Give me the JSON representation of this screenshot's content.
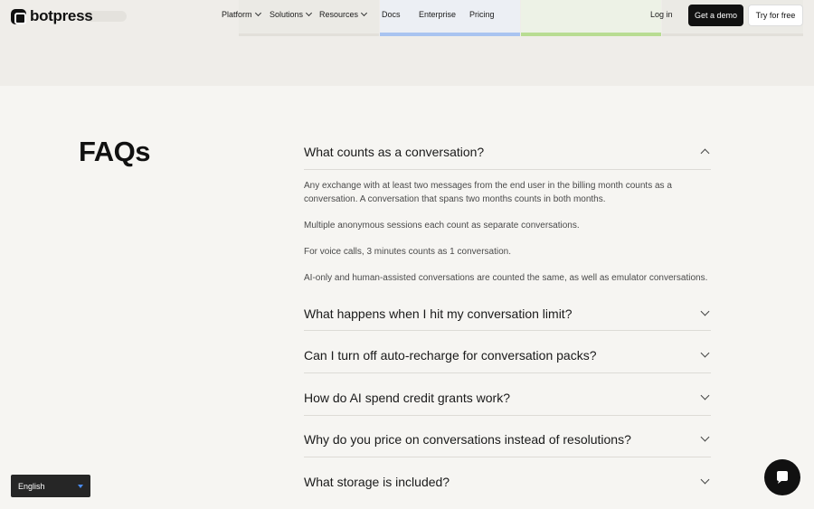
{
  "nav": {
    "brand": "botpress",
    "items": [
      {
        "label": "Platform",
        "has_dropdown": true
      },
      {
        "label": "Solutions",
        "has_dropdown": true
      },
      {
        "label": "Resources",
        "has_dropdown": true
      },
      {
        "label": "Docs",
        "has_dropdown": false
      },
      {
        "label": "Enterprise",
        "has_dropdown": false
      },
      {
        "label": "Pricing",
        "has_dropdown": false
      }
    ],
    "login": "Log in",
    "demo": "Get a demo",
    "try": "Try for free"
  },
  "faq": {
    "title": "FAQs",
    "items": [
      {
        "question": "What counts as a conversation?",
        "open": true,
        "answer": [
          "Any exchange with at least two messages from the end user in the billing month counts as a conversation. A conversation that spans two months counts in both months.",
          "Multiple anonymous sessions each count as separate conversations.",
          "For voice calls, 3 minutes counts as 1 conversation.",
          "AI-only and human-assisted conversations are counted the same, as well as emulator conversations."
        ]
      },
      {
        "question": "What happens when I hit my conversation limit?",
        "open": false
      },
      {
        "question": "Can I turn off auto-recharge for conversation packs?",
        "open": false
      },
      {
        "question": "How do AI spend credit grants work?",
        "open": false
      },
      {
        "question": "Why do you price on conversations instead of resolutions?",
        "open": false
      },
      {
        "question": "What storage is included?",
        "open": false
      }
    ]
  },
  "language": {
    "selected": "English"
  },
  "colors": {
    "accent_blue": "#a9c4f0",
    "accent_green": "#b8dc92",
    "dark": "#111111"
  },
  "icons": {
    "logo": "botpress-logo-icon",
    "chat": "chat-bubble-icon",
    "chevron": "chevron-icon"
  }
}
